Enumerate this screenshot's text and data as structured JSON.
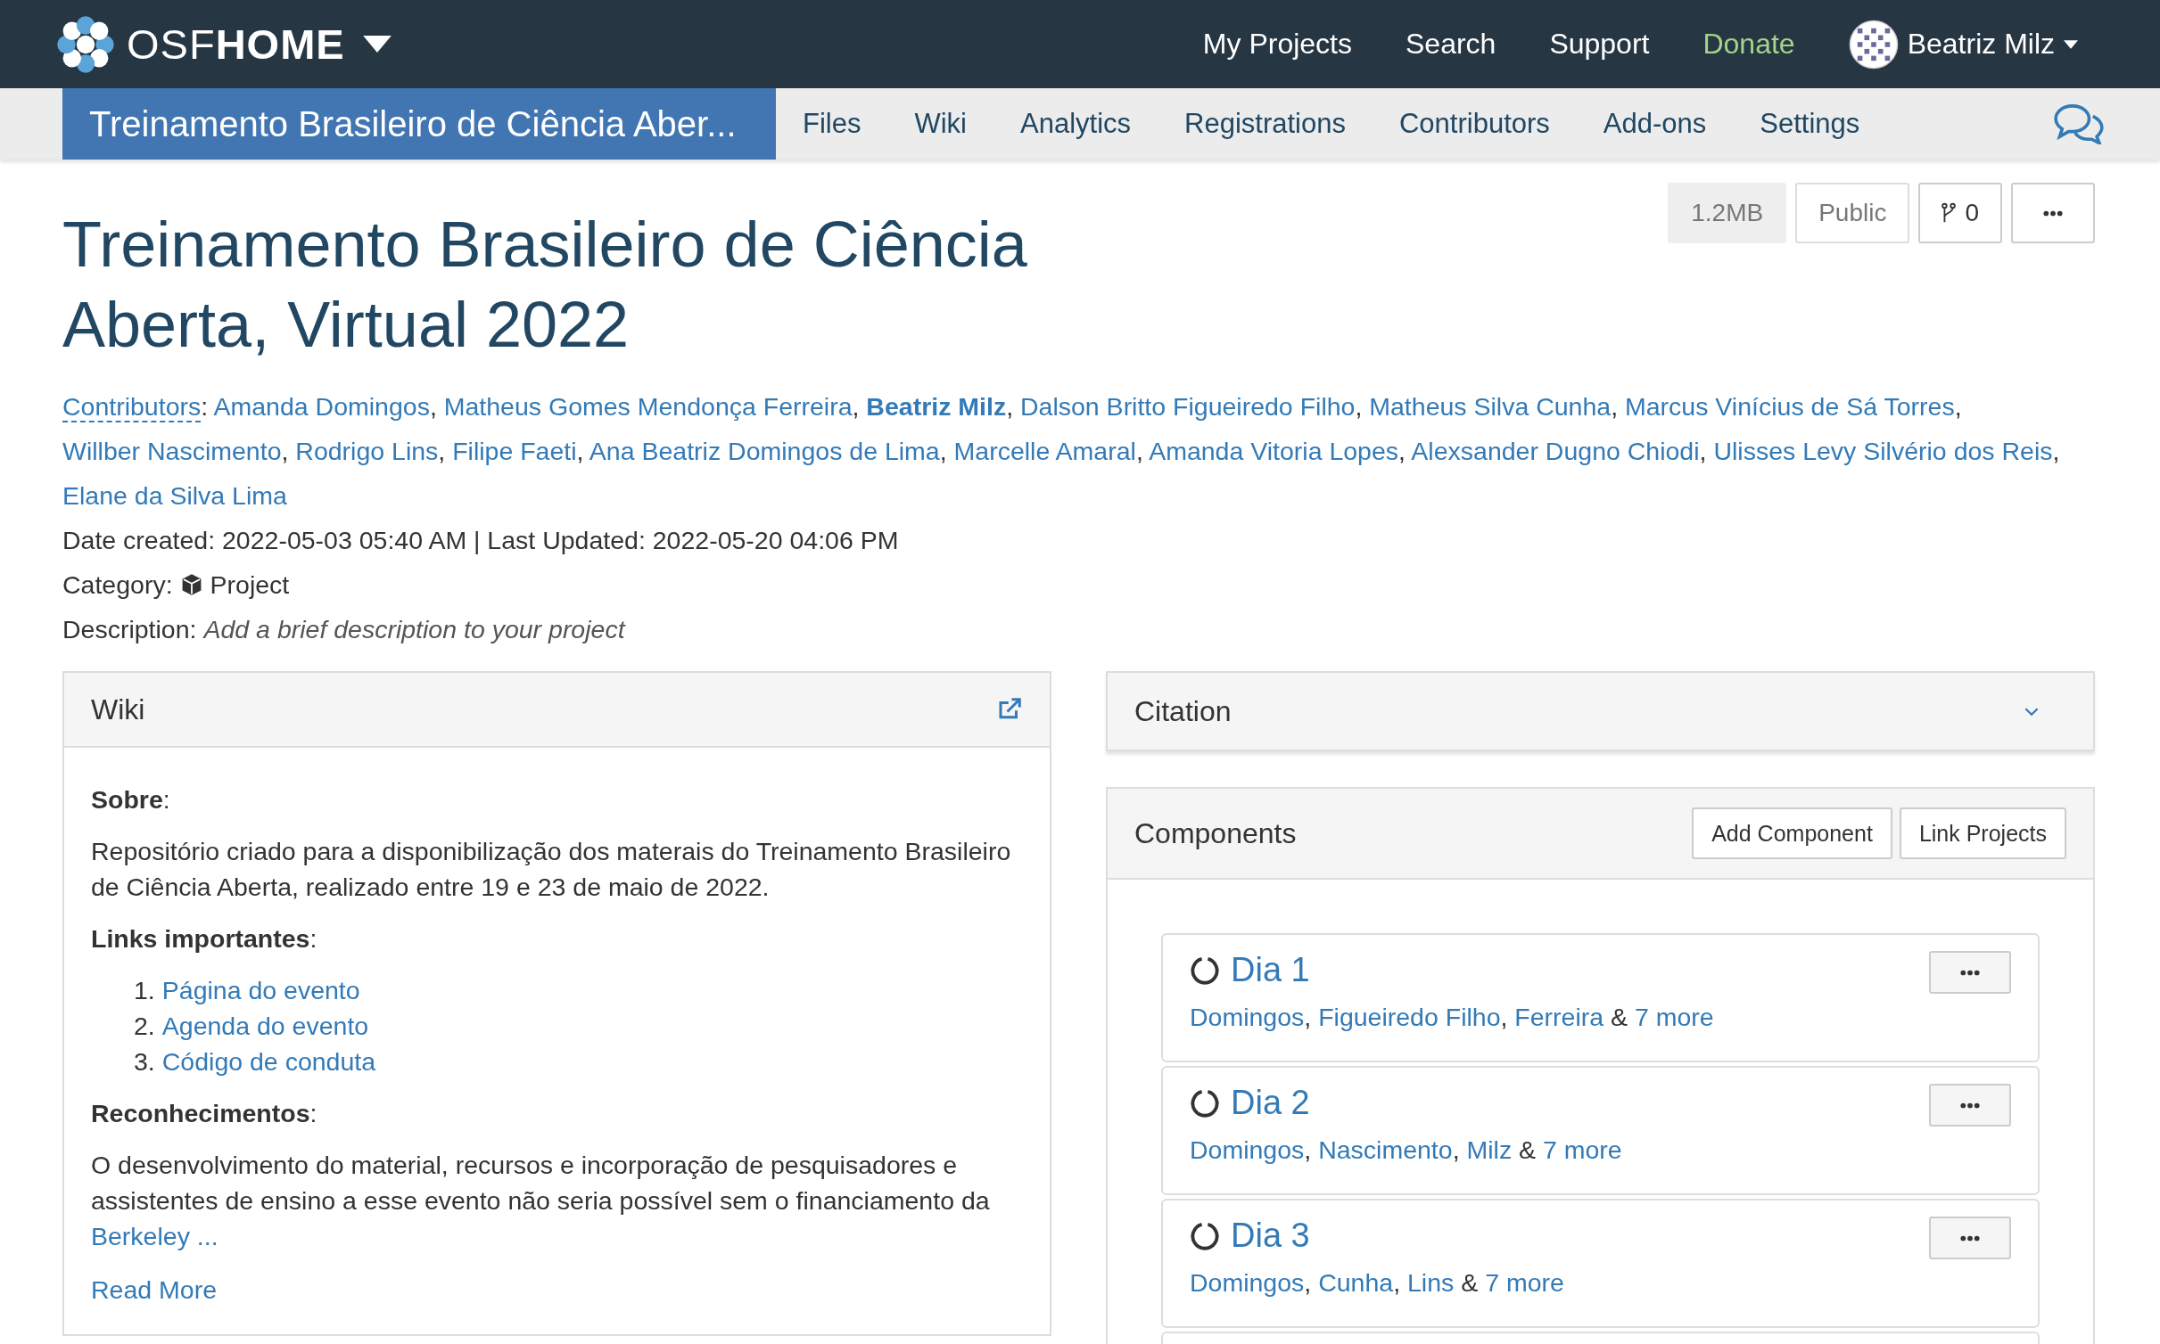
{
  "navbar": {
    "brand_light": "OSF",
    "brand_bold": "HOME",
    "links": [
      {
        "label": "My Projects",
        "kind": "link"
      },
      {
        "label": "Search",
        "kind": "link"
      },
      {
        "label": "Support",
        "kind": "link"
      },
      {
        "label": "Donate",
        "kind": "donate"
      }
    ],
    "user": {
      "name": "Beatriz Milz"
    }
  },
  "project_nav": {
    "items": [
      {
        "label": "Treinamento Brasileiro de Ciência Aber...",
        "kind": "title",
        "selected": true
      },
      {
        "label": "Files",
        "kind": "tab",
        "selected": false
      },
      {
        "label": "Wiki",
        "kind": "tab",
        "selected": false
      },
      {
        "label": "Analytics",
        "kind": "tab",
        "selected": false
      },
      {
        "label": "Registrations",
        "kind": "tab",
        "selected": false
      },
      {
        "label": "Contributors",
        "kind": "tab",
        "selected": false
      },
      {
        "label": "Add-ons",
        "kind": "tab",
        "selected": false
      },
      {
        "label": "Settings",
        "kind": "tab",
        "selected": false
      }
    ]
  },
  "header": {
    "title": "Treinamento Brasileiro de Ciência Aberta, Virtual 2022",
    "size": "1.2MB",
    "visibility": "Public",
    "forks": "0"
  },
  "contributors": {
    "label": "Contributors",
    "colon": ":",
    "separator": ",",
    "people": [
      {
        "name": "Amanda Domingos",
        "current": false
      },
      {
        "name": "Matheus Gomes Mendonça Ferreira",
        "current": false
      },
      {
        "name": "Beatriz Milz",
        "current": true
      },
      {
        "name": "Dalson Britto Figueiredo Filho",
        "current": false
      },
      {
        "name": "Matheus Silva Cunha",
        "current": false
      },
      {
        "name": "Marcus Vinícius de Sá Torres",
        "current": false
      },
      {
        "name": "Willber Nascimento",
        "current": false
      },
      {
        "name": "Rodrigo Lins",
        "current": false
      },
      {
        "name": "Filipe Faeti",
        "current": false
      },
      {
        "name": "Ana Beatriz Domingos de Lima",
        "current": false
      },
      {
        "name": "Marcelle Amaral",
        "current": false
      },
      {
        "name": "Amanda Vitoria Lopes",
        "current": false
      },
      {
        "name": "Alexsander Dugno Chiodi",
        "current": false
      },
      {
        "name": "Ulisses Levy Silvério dos Reis",
        "current": false
      },
      {
        "name": "Elane da Silva Lima",
        "current": false
      }
    ]
  },
  "meta": {
    "dates": "Date created: 2022-05-03 05:40 AM | Last Updated: 2022-05-20 04:06 PM",
    "category_label": "Category:",
    "category": "Project",
    "description_label": "Description:",
    "description": "Add a brief description to your project"
  },
  "wiki": {
    "title": "Wiki",
    "blocks": [
      {
        "kind": "heading",
        "text": "**Sobre**:"
      },
      {
        "kind": "paragraph",
        "text": "Repositório criado para a disponibilização dos materais do Treinamento Brasileiro de Ciência Aberta, realizado entre 19 e 23 de maio de 2022."
      },
      {
        "kind": "heading",
        "text": "**Links importantes**:"
      },
      {
        "kind": "list",
        "items": [
          {
            "number": "1.",
            "label": "Página do evento"
          },
          {
            "number": "2.",
            "label": "Agenda do evento"
          },
          {
            "number": "3.",
            "label": "Código de conduta"
          }
        ]
      },
      {
        "kind": "heading",
        "text": "**Reconhecimentos**:"
      },
      {
        "kind": "paragraph",
        "text": "O desenvolvimento do material, recursos e incorporação de pesquisadores e assistentes de ensino a esse evento não seria possível sem o financiamento da",
        "link": "Berkeley ..."
      }
    ],
    "read_more": "Read More"
  },
  "citation": {
    "title": "Citation",
    "expanded": false
  },
  "components": {
    "title": "Components",
    "buttons": [
      "Add Component",
      "Link Projects"
    ],
    "separator": ",",
    "conjunction": "&",
    "items": [
      {
        "title": "Dia 1",
        "authors": [
          "Domingos",
          "Figueiredo Filho",
          "Ferreira"
        ],
        "more": "7 more"
      },
      {
        "title": "Dia 2",
        "authors": [
          "Domingos",
          "Nascimento",
          "Milz"
        ],
        "more": "7 more"
      },
      {
        "title": "Dia 3",
        "authors": [
          "Domingos",
          "Cunha",
          "Lins"
        ],
        "more": "7 more"
      }
    ]
  }
}
